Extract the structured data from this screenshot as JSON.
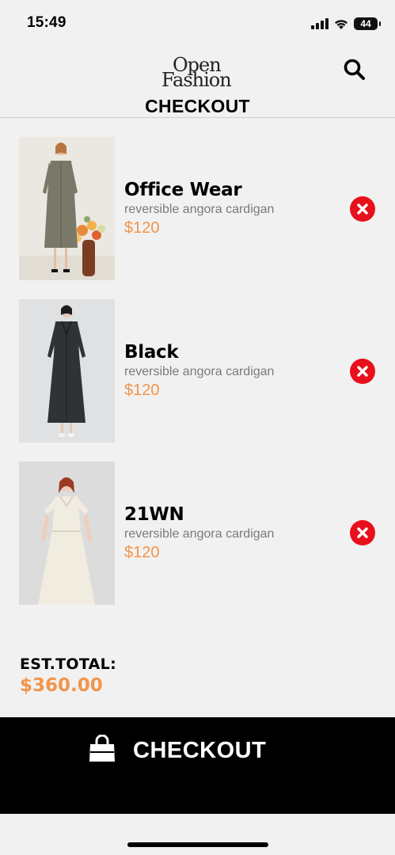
{
  "status_bar": {
    "time": "15:49",
    "battery": "44"
  },
  "header": {
    "logo_line1": "Open",
    "logo_line2": "Fashion",
    "title": "CHECKOUT",
    "search_icon": "search-icon"
  },
  "cart": {
    "items": [
      {
        "name": "Office Wear",
        "description": "reversible angora cardigan",
        "price": "$120",
        "remove_icon": "close-icon"
      },
      {
        "name": "Black",
        "description": "reversible angora cardigan",
        "price": "$120",
        "remove_icon": "close-icon"
      },
      {
        "name": "21WN",
        "description": "reversible angora cardigan",
        "price": "$120",
        "remove_icon": "close-icon"
      }
    ]
  },
  "summary": {
    "total_label": "EST.TOTAL:",
    "total_value": "$360.00"
  },
  "checkout_button": {
    "label": "CHECKOUT",
    "icon": "shopping-bag-icon"
  },
  "colors": {
    "accent": "#f2944b",
    "remove": "#e8101c",
    "background": "#f1f1f1",
    "bar": "#000000"
  }
}
